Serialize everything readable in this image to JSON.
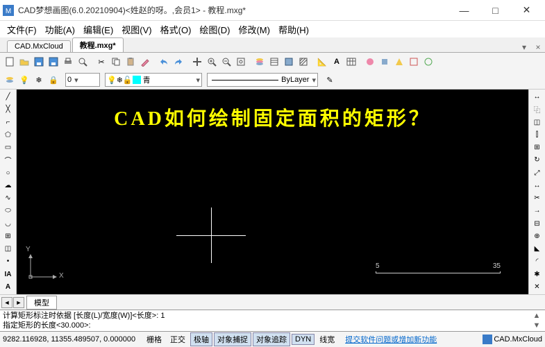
{
  "window": {
    "title": "CAD梦想画图(6.0.20210904)<姓赵的呀。,会员1> - 教程.mxg*",
    "min": "—",
    "max": "□",
    "close": "✕"
  },
  "menu": {
    "file": "文件(F)",
    "func": "功能(A)",
    "edit": "编辑(E)",
    "view": "视图(V)",
    "format": "格式(O)",
    "draw": "绘图(D)",
    "modify": "修改(M)",
    "help": "帮助(H)"
  },
  "tabs": {
    "t1": "CAD.MxCloud",
    "t2": "教程.mxg*",
    "menu": "▾",
    "close": "×"
  },
  "layer": {
    "name": "青",
    "linetype": "ByLayer"
  },
  "canvas": {
    "headline": "CAD如何绘制固定面积的矩形？",
    "x": "X",
    "y": "Y",
    "scale_left": "5",
    "scale_right": "35"
  },
  "model": {
    "left": "◄",
    "right": "►",
    "tab": "模型"
  },
  "cmd": {
    "line1": "计算矩形标注时依据 [长度(L)/宽度(W)]<长度>: 1",
    "line2": "指定矩形的长度<30.000>:",
    "up": "▲",
    "down": "▼"
  },
  "status": {
    "coords": "9282.116928, 11355.489507, 0.000000",
    "grid": "栅格",
    "ortho": "正交",
    "polar": "极轴",
    "osnap": "对象捕捉",
    "otrack": "对象追踪",
    "dyn": "DYN",
    "lwt": "线宽",
    "feedback": "提交软件问题或增加新功能",
    "brand": "CAD.MxCloud"
  }
}
